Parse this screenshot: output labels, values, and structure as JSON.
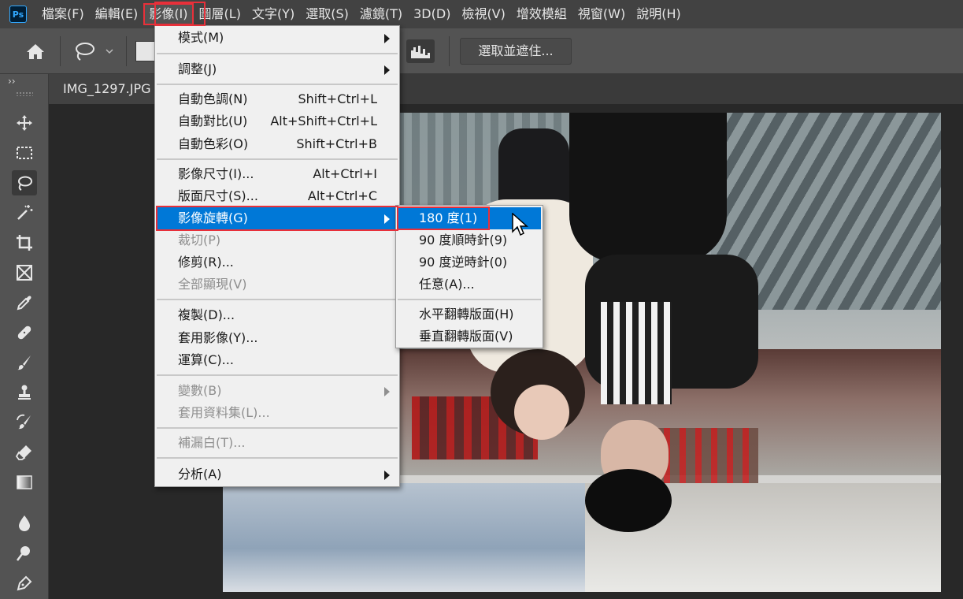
{
  "app": {
    "logo_text": "Ps"
  },
  "menubar": {
    "items": [
      {
        "label": "檔案(F)"
      },
      {
        "label": "編輯(E)"
      },
      {
        "label": "影像(I)"
      },
      {
        "label": "圖層(L)"
      },
      {
        "label": "文字(Y)"
      },
      {
        "label": "選取(S)"
      },
      {
        "label": "濾鏡(T)"
      },
      {
        "label": "3D(D)"
      },
      {
        "label": "檢視(V)"
      },
      {
        "label": "增效模組"
      },
      {
        "label": "視窗(W)"
      },
      {
        "label": "說明(H)"
      }
    ]
  },
  "options_bar": {
    "select_mask_label": "選取並遮住..."
  },
  "toolbox": {
    "collapse_label": "››"
  },
  "document": {
    "tab_title": "IMG_1297.JPG @"
  },
  "image_menu": {
    "mode": "模式(M)",
    "adjust": "調整(J)",
    "auto_tone": {
      "label": "自動色調(N)",
      "shortcut": "Shift+Ctrl+L"
    },
    "auto_contrast": {
      "label": "自動對比(U)",
      "shortcut": "Alt+Shift+Ctrl+L"
    },
    "auto_color": {
      "label": "自動色彩(O)",
      "shortcut": "Shift+Ctrl+B"
    },
    "image_size": {
      "label": "影像尺寸(I)...",
      "shortcut": "Alt+Ctrl+I"
    },
    "canvas_size": {
      "label": "版面尺寸(S)...",
      "shortcut": "Alt+Ctrl+C"
    },
    "image_rotation": "影像旋轉(G)",
    "crop": "裁切(P)",
    "trim": "修剪(R)...",
    "reveal_all": "全部顯現(V)",
    "duplicate": "複製(D)...",
    "apply_image": "套用影像(Y)...",
    "calculations": "運算(C)...",
    "variables": "變數(B)",
    "apply_data_set": "套用資料集(L)...",
    "trap": "補漏白(T)...",
    "analysis": "分析(A)"
  },
  "rotation_submenu": {
    "r180": "180 度(1)",
    "r90cw": "90 度順時針(9)",
    "r90ccw": "90 度逆時針(0)",
    "arbitrary": "任意(A)...",
    "flip_h": "水平翻轉版面(H)",
    "flip_v": "垂直翻轉版面(V)"
  }
}
